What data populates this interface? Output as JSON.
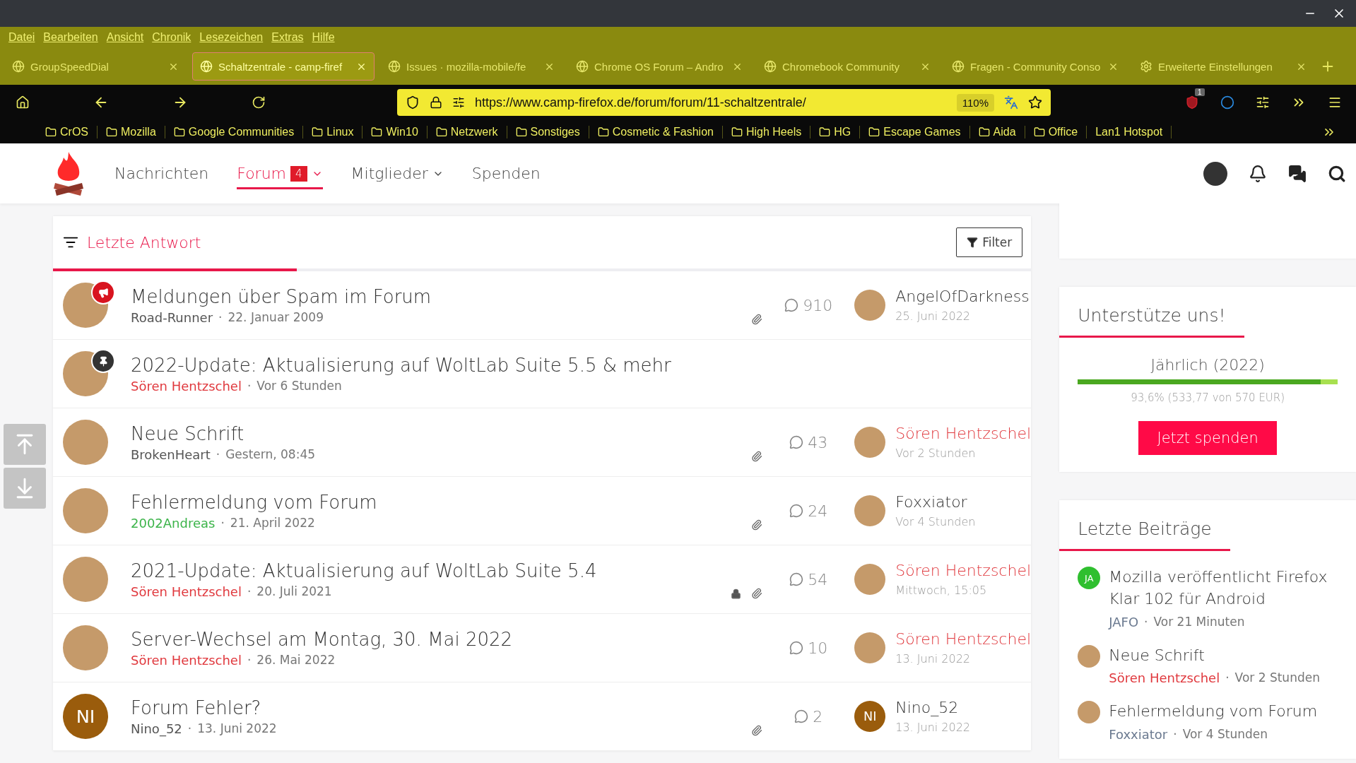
{
  "menu": [
    "Datei",
    "Bearbeiten",
    "Ansicht",
    "Chronik",
    "Lesezeichen",
    "Extras",
    "Hilfe"
  ],
  "tabs": [
    {
      "title": "GroupSpeedDial",
      "selected": false
    },
    {
      "title": "Schaltzentrale - camp-firef",
      "selected": true
    },
    {
      "title": "Issues · mozilla-mobile/fe",
      "selected": false
    },
    {
      "title": "Chrome OS Forum – Andro",
      "selected": false
    },
    {
      "title": "Chromebook Community",
      "selected": false
    },
    {
      "title": "Fragen - Community Conso",
      "selected": false
    },
    {
      "title": "Erweiterte Einstellungen",
      "selected": false
    }
  ],
  "toolbar": {
    "url": "https://www.camp-firefox.de/forum/forum/11-schaltzentrale/",
    "zoom": "110%",
    "extension_badge": "1"
  },
  "bookmarks": [
    {
      "label": "CrOS",
      "kind": "folder"
    },
    {
      "label": "Mozilla",
      "kind": "folder"
    },
    {
      "label": "Google Communities",
      "kind": "folder"
    },
    {
      "label": "Linux",
      "kind": "folder"
    },
    {
      "label": "Win10",
      "kind": "folder"
    },
    {
      "label": "Netzwerk",
      "kind": "folder"
    },
    {
      "label": "Sonstiges",
      "kind": "folder"
    },
    {
      "label": "Cosmetic & Fashion",
      "kind": "folder"
    },
    {
      "label": "High Heels",
      "kind": "folder"
    },
    {
      "label": "HG",
      "kind": "folder"
    },
    {
      "label": "Escape Games",
      "kind": "folder"
    },
    {
      "label": "Aida",
      "kind": "folder"
    },
    {
      "label": "Office",
      "kind": "folder"
    },
    {
      "label": "Lan1 Hotspot",
      "kind": "link"
    }
  ],
  "site_nav": [
    {
      "label": "Nachrichten",
      "selected": false,
      "dropdown": false
    },
    {
      "label": "Forum",
      "selected": true,
      "badge": "4",
      "dropdown": true
    },
    {
      "label": "Mitglieder",
      "selected": false,
      "dropdown": true
    },
    {
      "label": "Spenden",
      "selected": false,
      "dropdown": false
    }
  ],
  "separator": "·",
  "topic_list": {
    "sort_label": "Letzte Antwort",
    "filter_label": "Filter",
    "topics": [
      {
        "title": "Meldungen über Spam im Forum",
        "avatar": {
          "kind": "photo"
        },
        "kind": "announcement",
        "author": {
          "name": "Road-Runner",
          "color": "#555555"
        },
        "date": "22. Januar 2009",
        "closed": false,
        "attachment": true,
        "replies": "910",
        "last": {
          "name": "AngelOfDarkness",
          "color": "#333333",
          "time": "25. Juni 2022",
          "avatar": {
            "kind": "photo"
          }
        }
      },
      {
        "title": "2022-Update: Aktualisierung auf WoltLab Suite 5.5 & mehr",
        "avatar": {
          "kind": "photo"
        },
        "kind": "pinned",
        "author": {
          "name": "Sören Hentzschel",
          "color": "#e0393e"
        },
        "date": "Vor 6 Stunden",
        "closed": false,
        "attachment": false
      },
      {
        "title": "Neue Schrift",
        "avatar": {
          "kind": "photo"
        },
        "author": {
          "name": "BrokenHeart",
          "color": "#555555"
        },
        "date": "Gestern, 08:45",
        "closed": false,
        "attachment": true,
        "replies": "43",
        "last": {
          "name": "Sören Hentzschel",
          "color": "#e0393e",
          "time": "Vor 2 Stunden",
          "avatar": {
            "kind": "photo"
          }
        }
      },
      {
        "title": "Fehlermeldung vom Forum",
        "avatar": {
          "kind": "photo"
        },
        "author": {
          "name": "2002Andreas",
          "color": "#3cb44a"
        },
        "date": "21. April 2022",
        "closed": false,
        "attachment": true,
        "replies": "24",
        "last": {
          "name": "Foxxiator",
          "color": "#333333",
          "time": "Vor 4 Stunden",
          "avatar": {
            "kind": "photo"
          }
        }
      },
      {
        "title": "2021-Update: Aktualisierung auf WoltLab Suite 5.4",
        "avatar": {
          "kind": "photo"
        },
        "author": {
          "name": "Sören Hentzschel",
          "color": "#e0393e"
        },
        "date": "20. Juli 2021",
        "closed": true,
        "attachment": true,
        "replies": "54",
        "last": {
          "name": "Sören Hentzschel",
          "color": "#e0393e",
          "time": "Mittwoch, 15:05",
          "avatar": {
            "kind": "photo"
          }
        }
      },
      {
        "title": "Server-Wechsel am Montag, 30. Mai 2022",
        "avatar": {
          "kind": "photo"
        },
        "author": {
          "name": "Sören Hentzschel",
          "color": "#e0393e"
        },
        "date": "26. Mai 2022",
        "closed": false,
        "attachment": false,
        "replies": "10",
        "last": {
          "name": "Sören Hentzschel",
          "color": "#e0393e",
          "time": "13. Juni 2022",
          "avatar": {
            "kind": "photo"
          }
        }
      },
      {
        "title": "Forum Fehler?",
        "avatar": {
          "kind": "initials",
          "initials": "NI",
          "color": "#9a5c0c"
        },
        "author": {
          "name": "Nino_52",
          "color": "#555555"
        },
        "date": "13. Juni 2022",
        "closed": false,
        "attachment": true,
        "replies": "2",
        "last": {
          "name": "Nino_52",
          "color": "#333333",
          "time": "13. Juni 2022",
          "avatar": {
            "kind": "initials",
            "initials": "NI",
            "color": "#9a5c0c"
          }
        }
      }
    ]
  },
  "sidebar": {
    "support": {
      "title": "Unterstütze uns!",
      "period": "Jährlich (2022)",
      "level": 0.936,
      "summary": "93,6% (533,77 von 570 EUR)",
      "button": "Jetzt spenden"
    },
    "recent": {
      "title": "Letzte Beiträge",
      "posts": [
        {
          "title": "Mozilla veröffentlicht Firefox Klar 102 für Android",
          "author": {
            "name": "JAFO",
            "color": "#6b7a90"
          },
          "time": "Vor 21 Minuten",
          "avatar": {
            "kind": "initials",
            "initials": "JA",
            "color": "#2fbf2f"
          }
        },
        {
          "title": "Neue Schrift",
          "author": {
            "name": "Sören Hentzschel",
            "color": "#e0393e"
          },
          "time": "Vor 2 Stunden",
          "avatar": {
            "kind": "photo"
          }
        },
        {
          "title": "Fehlermeldung vom Forum",
          "author": {
            "name": "Foxxiator",
            "color": "#6b7a90"
          },
          "time": "Vor 4 Stunden",
          "avatar": {
            "kind": "photo"
          }
        }
      ]
    }
  }
}
